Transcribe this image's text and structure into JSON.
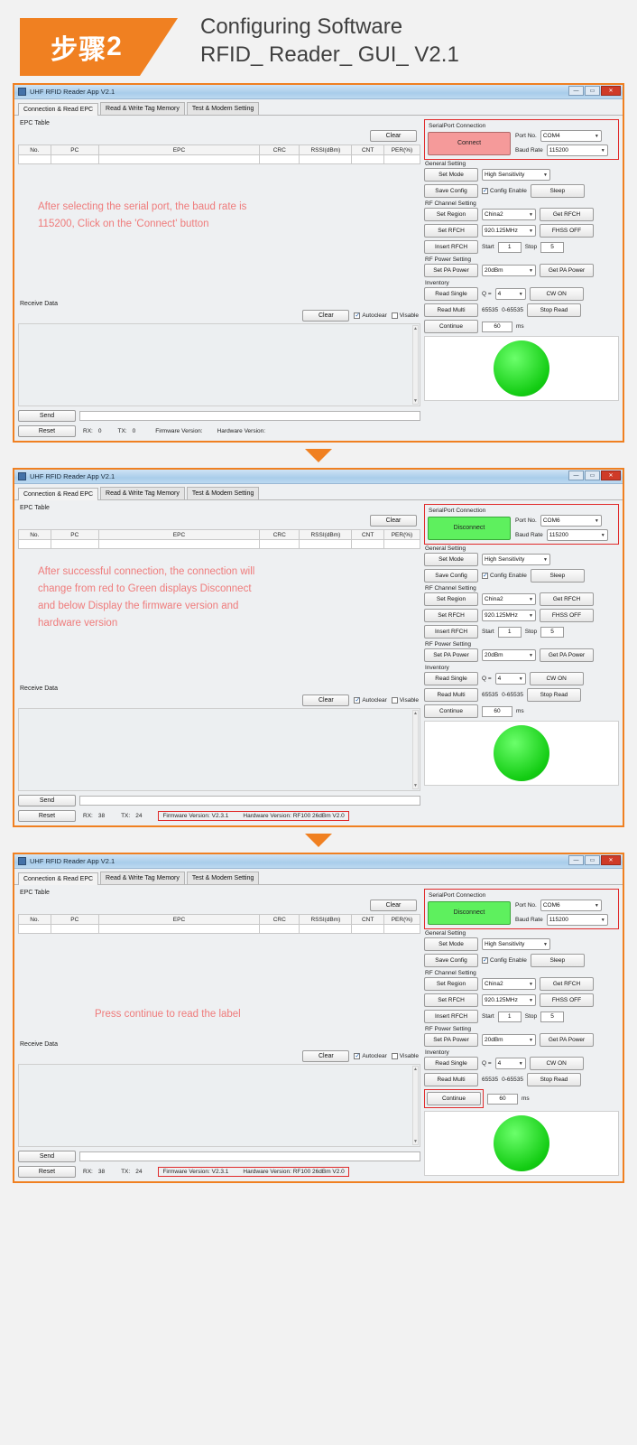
{
  "header": {
    "step_cn": "步骤",
    "step_num": "2",
    "title_line1": "Configuring Software",
    "title_line2": "RFID_ Reader_ GUI_ V2.1"
  },
  "window": {
    "title": "UHF RFID Reader App V2.1",
    "minimize": "—",
    "maximize": "▭",
    "close": "✕"
  },
  "tabs": [
    {
      "label": "Connection & Read EPC"
    },
    {
      "label": "Read & Write Tag Memory"
    },
    {
      "label": "Test & Modem Setting"
    }
  ],
  "epc_table": {
    "group_label": "EPC Table",
    "clear_label": "Clear",
    "columns": [
      "No.",
      "PC",
      "EPC",
      "CRC",
      "RSSI(dBm)",
      "CNT",
      "PER(%)"
    ]
  },
  "receive": {
    "group_label": "Receive Data",
    "clear_label": "Clear",
    "autoclear_label": "Autoclear",
    "visable_label": "Visable",
    "send_label": "Send",
    "reset_label": "Reset",
    "rx_label": "RX:",
    "tx_label": "TX:",
    "firmware_label": "Firmware Version:",
    "hardware_label": "Hardware Version:"
  },
  "serial": {
    "section_title": "SerialPort Connection",
    "connect_label": "Connect",
    "disconnect_label": "Disconnect",
    "port_label": "Port No.",
    "baud_label": "Baud Rate",
    "port_com4": "COM4",
    "port_com6": "COM6",
    "baud_value": "115200",
    "connect_color": "#f59a9a",
    "disconnect_color": "#5ef05e"
  },
  "general": {
    "section_title": "General Setting",
    "set_mode_label": "Set Mode",
    "mode_value": "High Sensitivity",
    "save_config_label": "Save Config",
    "config_enable_label": "Config Enable",
    "sleep_label": "Sleep"
  },
  "rf_channel": {
    "section_title": "RF Channel Setting",
    "set_region_label": "Set Region",
    "region_value": "China2",
    "get_rfch_label": "Get RFCH",
    "set_rfch_label": "Set RFCH",
    "freq_value": "920.125MHz",
    "fhss_label": "FHSS OFF",
    "insert_rfch_label": "Insert RFCH",
    "start_label": "Start",
    "start_value": "1",
    "stop_label": "Stop",
    "stop_value": "5"
  },
  "rf_power": {
    "section_title": "RF Power Setting",
    "set_pa_label": "Set PA Power",
    "power_value": "20dBm",
    "get_pa_label": "Get PA Power"
  },
  "inventory": {
    "section_title": "Inventory",
    "read_single_label": "Read Single",
    "q_label": "Q =",
    "q_value": "4",
    "cw_on_label": "CW ON",
    "read_multi_label": "Read Multi",
    "count_value": "65535",
    "count_range": "0-65535",
    "stop_read_label": "Stop Read",
    "continue_label": "Continue",
    "interval_value": "60",
    "interval_unit": "ms"
  },
  "panels": [
    {
      "port": "COM4",
      "conn_button": "Connect",
      "rx": "0",
      "tx": "0",
      "firmware_value": "",
      "hardware_value": "",
      "annotation": [
        "After selecting the serial port, the baud rate is",
        "115200, Click on the 'Connect' button"
      ]
    },
    {
      "port": "COM6",
      "conn_button": "Disconnect",
      "rx": "38",
      "tx": "24",
      "firmware_value": "V2.3.1",
      "hardware_value": "RF100 26dBm V2.0",
      "annotation": [
        "After successful connection, the connection will",
        "change from red to Green displays Disconnect",
        "and below Display the firmware version and",
        "hardware version"
      ]
    },
    {
      "port": "COM6",
      "conn_button": "Disconnect",
      "rx": "38",
      "tx": "24",
      "firmware_value": "V2.3.1",
      "hardware_value": "RF100 26dBm V2.0",
      "annotation": [
        "Press continue to read the label"
      ]
    }
  ],
  "colors": {
    "accent_orange": "#F08021",
    "annotation_red": "#ef7b7b",
    "highlight_box": "#e02b2b"
  }
}
